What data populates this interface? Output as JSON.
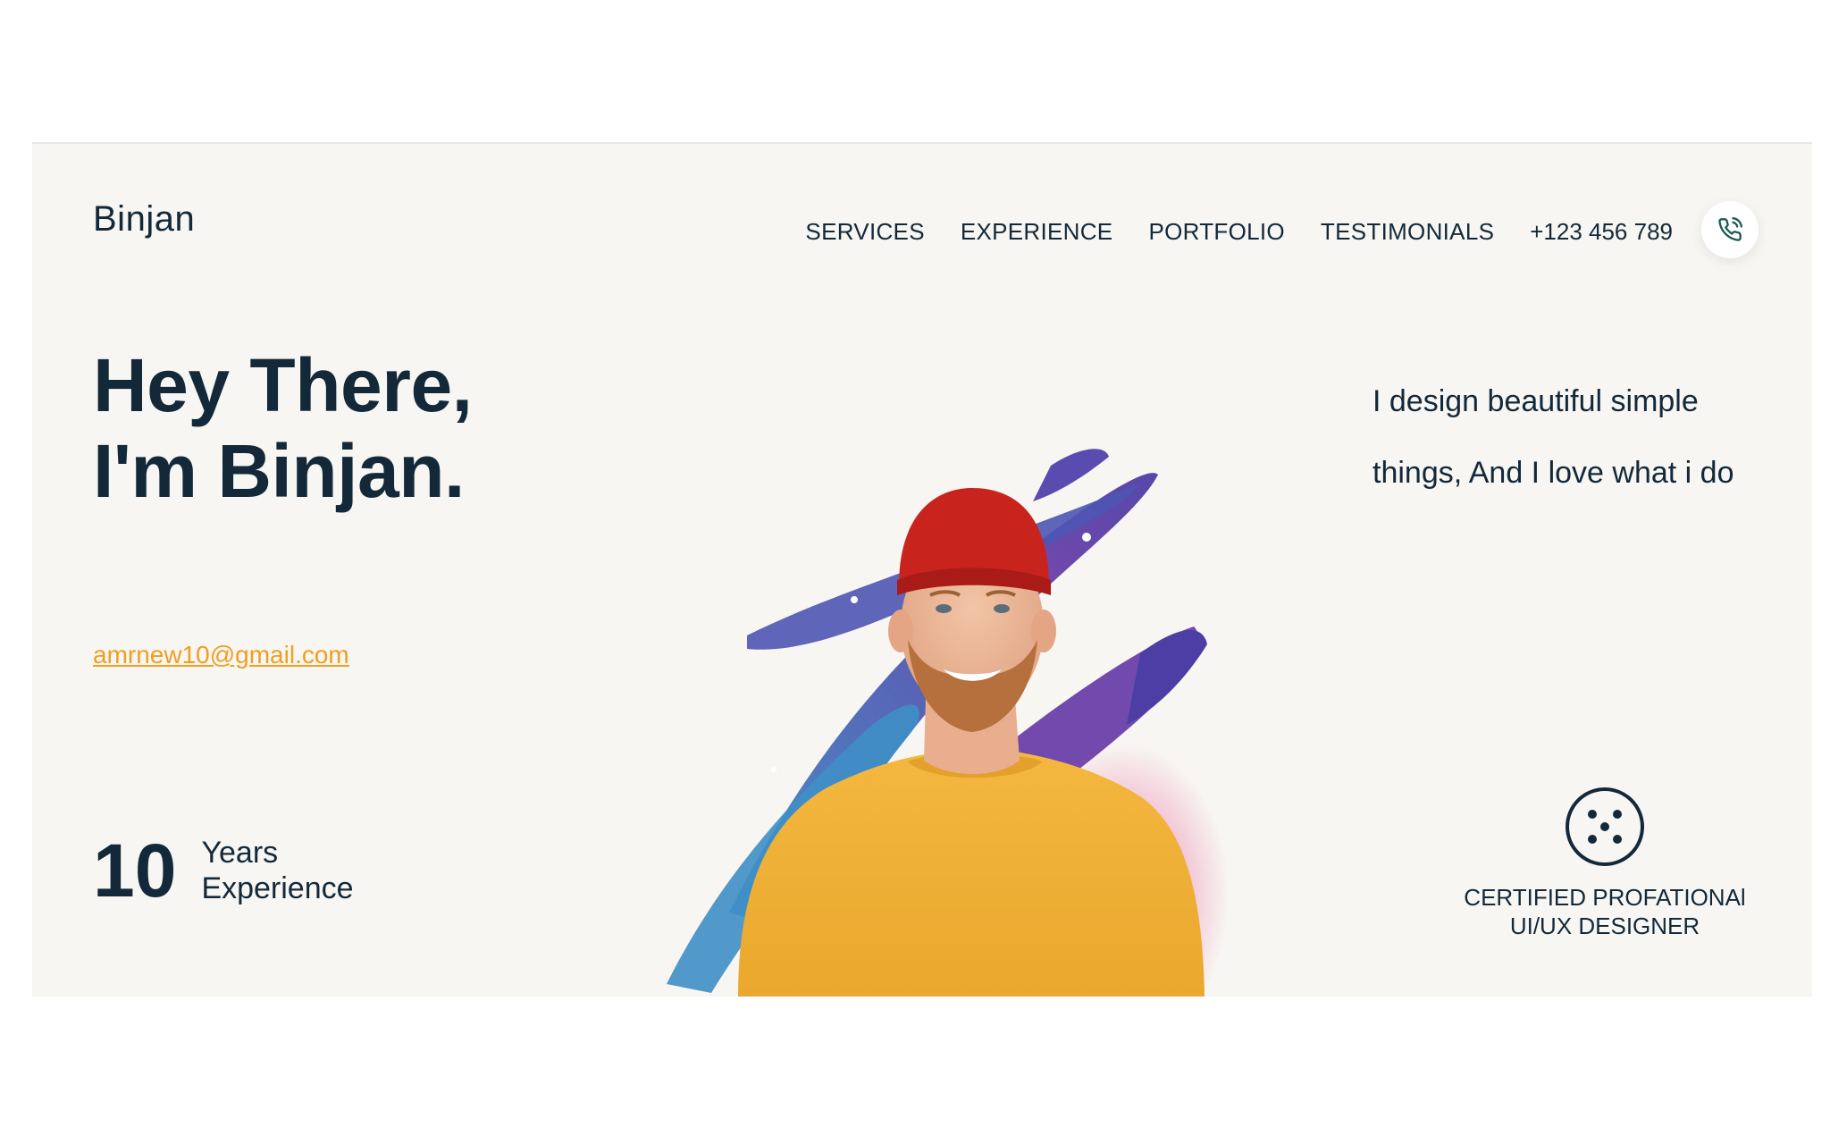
{
  "brand": {
    "name": "Binjan"
  },
  "nav": {
    "items": [
      {
        "label": "SERVICES"
      },
      {
        "label": "EXPERIENCE"
      },
      {
        "label": "PORTFOLIO"
      },
      {
        "label": "TESTIMONIALS"
      }
    ],
    "phone": "+123 456 789",
    "call_icon": "phone-call-icon"
  },
  "hero": {
    "headline_line1": "Hey There,",
    "headline_line2": "I'm Binjan.",
    "email": "amrnew10@gmail.com",
    "tagline_line1": "I design beautiful simple",
    "tagline_line2": "things, And I love what i do",
    "experience": {
      "number": "10",
      "label_line1": "Years",
      "label_line2": "Experience"
    },
    "certification": {
      "icon": "dice-five-icon",
      "line1": "CERTIFIED PROFATIONAl",
      "line2": "UI/UX DESIGNER"
    }
  },
  "colors": {
    "text": "#13293a",
    "accent_email": "#f29e1f",
    "background": "#f7f6f2",
    "sweater": "#f0b13a",
    "beanie": "#c9231d"
  }
}
